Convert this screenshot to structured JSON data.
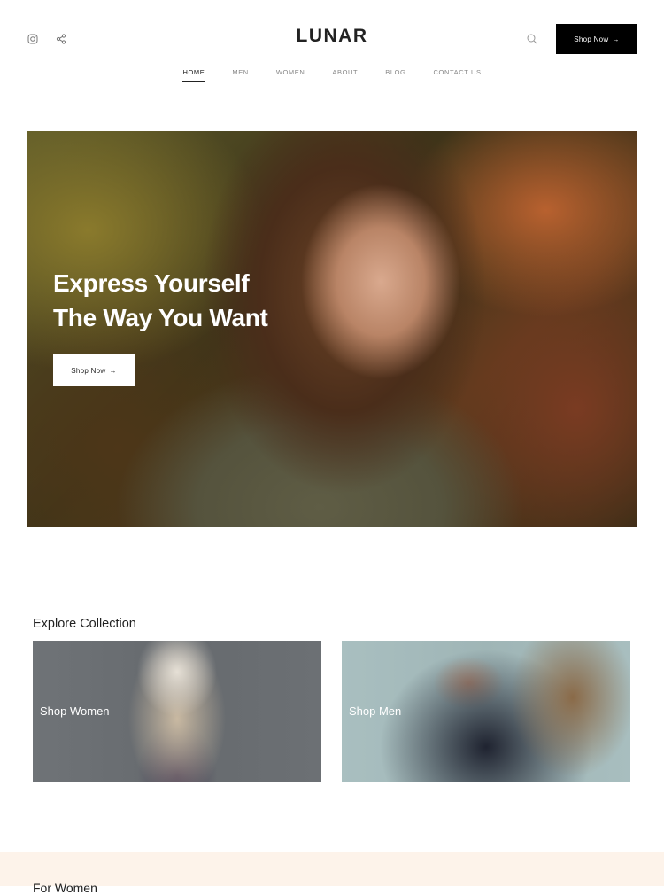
{
  "header": {
    "logo": "LUNAR",
    "social_icons": [
      "instagram-icon",
      "share-icon"
    ],
    "search_icon": "search-icon",
    "cta_label": "Shop Now",
    "cta_arrow": "→"
  },
  "nav": {
    "items": [
      {
        "label": "HOME",
        "active": true
      },
      {
        "label": "MEN",
        "active": false
      },
      {
        "label": "WOMEN",
        "active": false
      },
      {
        "label": "ABOUT",
        "active": false
      },
      {
        "label": "BLOG",
        "active": false
      },
      {
        "label": "CONTACT US",
        "active": false
      }
    ]
  },
  "hero": {
    "title_line1": "Express Yourself",
    "title_line2": "The Way You Want",
    "button_label": "Shop Now",
    "button_arrow": "→"
  },
  "collection": {
    "title": "Explore Collection",
    "cards": [
      {
        "label": "Shop Women"
      },
      {
        "label": "Shop Men"
      }
    ]
  },
  "bottom_section": {
    "title": "For Women",
    "background": "#fdf3ea"
  }
}
